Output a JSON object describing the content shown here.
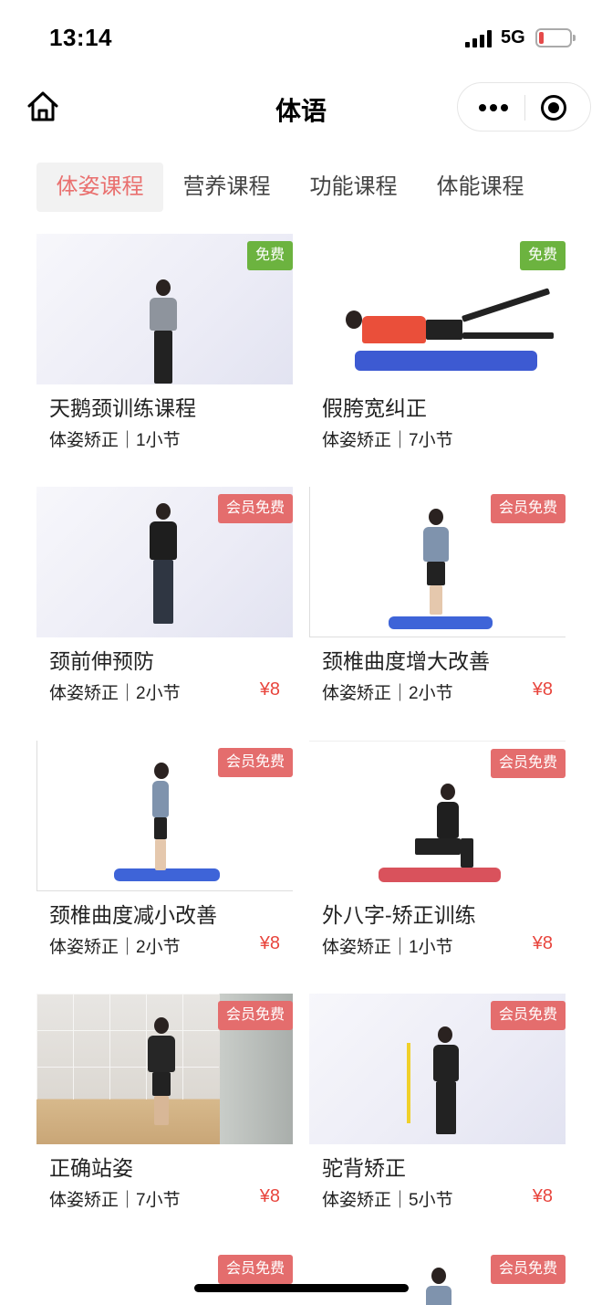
{
  "status_bar": {
    "time": "13:14",
    "network": "5G",
    "battery_level": 0.15
  },
  "nav": {
    "title": "体语",
    "home_icon": "home-icon",
    "menu_icon": "more-dots-icon",
    "close_icon": "target-circle-icon"
  },
  "tabs": [
    {
      "label": "体姿课程",
      "active": true
    },
    {
      "label": "营养课程",
      "active": false
    },
    {
      "label": "功能课程",
      "active": false
    },
    {
      "label": "体能课程",
      "active": false
    }
  ],
  "colors": {
    "accent": "#e9706f",
    "price": "#e8453d",
    "free_badge": "#6cb33f",
    "member_badge": "#e46d6d"
  },
  "courses": [
    {
      "title": "天鹅颈训练课程",
      "meta": "体姿矫正｜1小节",
      "badge": "免费",
      "badge_type": "free",
      "price": ""
    },
    {
      "title": "假胯宽纠正",
      "meta": "体姿矫正｜7小节",
      "badge": "免费",
      "badge_type": "free",
      "price": ""
    },
    {
      "title": "颈前伸预防",
      "meta": "体姿矫正｜2小节",
      "badge": "会员免费",
      "badge_type": "member",
      "price": "¥8"
    },
    {
      "title": "颈椎曲度增大改善",
      "meta": "体姿矫正｜2小节",
      "badge": "会员免费",
      "badge_type": "member",
      "price": "¥8"
    },
    {
      "title": "颈椎曲度减小改善",
      "meta": "体姿矫正｜2小节",
      "badge": "会员免费",
      "badge_type": "member",
      "price": "¥8"
    },
    {
      "title": "外八字-矫正训练",
      "meta": "体姿矫正｜1小节",
      "badge": "会员免费",
      "badge_type": "member",
      "price": "¥8"
    },
    {
      "title": "正确站姿",
      "meta": "体姿矫正｜7小节",
      "badge": "会员免费",
      "badge_type": "member",
      "price": "¥8"
    },
    {
      "title": "驼背矫正",
      "meta": "体姿矫正｜5小节",
      "badge": "会员免费",
      "badge_type": "member",
      "price": "¥8"
    },
    {
      "title": "",
      "meta": "",
      "badge": "会员免费",
      "badge_type": "member",
      "price": ""
    },
    {
      "title": "",
      "meta": "",
      "badge": "会员免费",
      "badge_type": "member",
      "price": ""
    }
  ]
}
